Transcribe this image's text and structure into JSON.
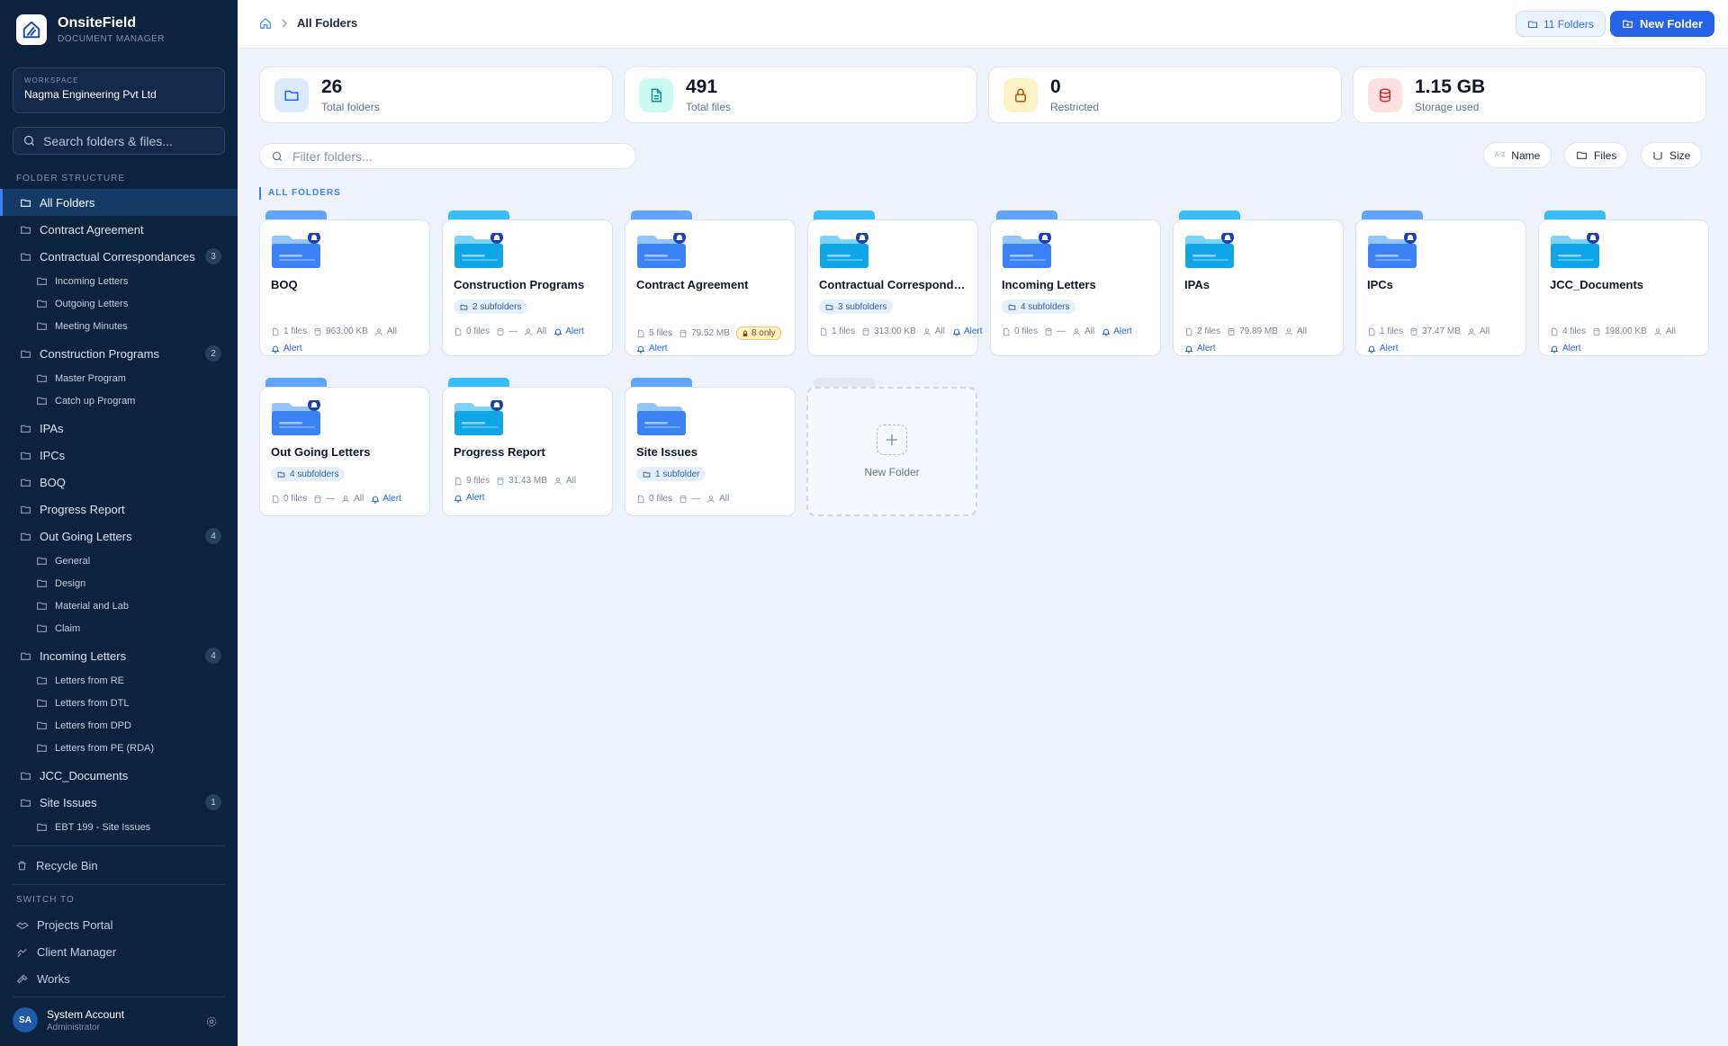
{
  "brand": {
    "name": "OnsiteField",
    "sub": "DOCUMENT MANAGER"
  },
  "workspace": {
    "label": "WORKSPACE",
    "name": "Nagma Engineering Pvt Ltd"
  },
  "sidebar_search": {
    "placeholder": "Search folders & files..."
  },
  "tree_label": "FOLDER STRUCTURE",
  "tree": [
    {
      "label": "All Folders",
      "level": 0,
      "active": true
    },
    {
      "label": "Contract Agreement",
      "level": 0
    },
    {
      "label": "Contractual Correspondances",
      "level": 0,
      "count": "3"
    },
    {
      "label": "Incoming Letters",
      "level": 1
    },
    {
      "label": "Outgoing Letters",
      "level": 1
    },
    {
      "label": "Meeting Minutes",
      "level": 1
    },
    {
      "label": "Construction Programs",
      "level": 0,
      "count": "2"
    },
    {
      "label": "Master Program",
      "level": 1
    },
    {
      "label": "Catch up Program",
      "level": 1
    },
    {
      "label": "IPAs",
      "level": 0
    },
    {
      "label": "IPCs",
      "level": 0
    },
    {
      "label": "BOQ",
      "level": 0
    },
    {
      "label": "Progress Report",
      "level": 0
    },
    {
      "label": "Out Going Letters",
      "level": 0,
      "count": "4"
    },
    {
      "label": "General",
      "level": 1
    },
    {
      "label": "Design",
      "level": 1
    },
    {
      "label": "Material and Lab",
      "level": 1
    },
    {
      "label": "Claim",
      "level": 1
    },
    {
      "label": "Incoming Letters",
      "level": 0,
      "count": "4"
    },
    {
      "label": "Letters from RE",
      "level": 1
    },
    {
      "label": "Letters from DTL",
      "level": 1
    },
    {
      "label": "Letters from DPD",
      "level": 1
    },
    {
      "label": "Letters from PE (RDA)",
      "level": 1
    },
    {
      "label": "JCC_Documents",
      "level": 0
    },
    {
      "label": "Site Issues",
      "level": 0,
      "count": "1"
    },
    {
      "label": "EBT 199 - Site Issues",
      "level": 1
    }
  ],
  "recycle_bin": "Recycle Bin",
  "switch_label": "SWITCH TO",
  "switch_links": [
    "Projects Portal",
    "Client Manager",
    "Works"
  ],
  "user": {
    "initials": "SA",
    "name": "System Account",
    "role": "Administrator"
  },
  "breadcrumb": {
    "current": "All Folders"
  },
  "topbar": {
    "folder_count": "11 Folders",
    "new_folder": "New Folder"
  },
  "stats": [
    {
      "value": "26",
      "label": "Total folders",
      "color": "#dbeafe",
      "icon_color": "#2563eb",
      "icon": "folder-icon"
    },
    {
      "value": "491",
      "label": "Total files",
      "color": "#ccfbf1",
      "icon_color": "#0d9488",
      "icon": "file-icon"
    },
    {
      "value": "0",
      "label": "Restricted",
      "color": "#fef3c7",
      "icon_color": "#b45309",
      "icon": "lock-icon"
    },
    {
      "value": "1.15 GB",
      "label": "Storage used",
      "color": "#fee2e2",
      "icon_color": "#dc2626",
      "icon": "database-icon"
    }
  ],
  "filter": {
    "placeholder": "Filter folders..."
  },
  "sort": {
    "name": "Name",
    "files": "Files",
    "size": "Size",
    "name_badge": "A-Z"
  },
  "section_heading": "ALL FOLDERS",
  "alert_label": "Alert",
  "new_folder_card": "New Folder",
  "folders": [
    {
      "name": "BOQ",
      "files": "1 files",
      "size": "963.00 KB",
      "access": "All",
      "alert": true,
      "color": "blue"
    },
    {
      "name": "Construction Programs",
      "subfolders": "2 subfolders",
      "files": "0 files",
      "size": "—",
      "access": "All",
      "alert": true,
      "color": "sky"
    },
    {
      "name": "Contract Agreement",
      "files": "5 files",
      "size": "79.52 MB",
      "restricted": "8 only",
      "alert": true,
      "color": "blue"
    },
    {
      "name": "Contractual Correspondances",
      "subfolders": "3 subfolders",
      "files": "1 files",
      "size": "313.00 KB",
      "access": "All",
      "alert": true,
      "color": "sky"
    },
    {
      "name": "Incoming Letters",
      "subfolders": "4 subfolders",
      "files": "0 files",
      "size": "—",
      "access": "All",
      "alert": true,
      "color": "blue"
    },
    {
      "name": "IPAs",
      "files": "2 files",
      "size": "79.89 MB",
      "access": "All",
      "alert": true,
      "color": "sky"
    },
    {
      "name": "IPCs",
      "files": "1 files",
      "size": "37.47 MB",
      "access": "All",
      "alert": true,
      "color": "blue"
    },
    {
      "name": "JCC_Documents",
      "files": "4 files",
      "size": "198.00 KB",
      "access": "All",
      "alert": true,
      "color": "sky"
    },
    {
      "name": "Out Going Letters",
      "subfolders": "4 subfolders",
      "files": "0 files",
      "size": "—",
      "access": "All",
      "alert": true,
      "color": "blue"
    },
    {
      "name": "Progress Report",
      "files": "9 files",
      "size": "31.43 MB",
      "access": "All",
      "alert": true,
      "color": "sky"
    },
    {
      "name": "Site Issues",
      "subfolders": "1 subfolder",
      "files": "0 files",
      "size": "—",
      "access": "All",
      "alert": false,
      "color": "blue"
    }
  ]
}
